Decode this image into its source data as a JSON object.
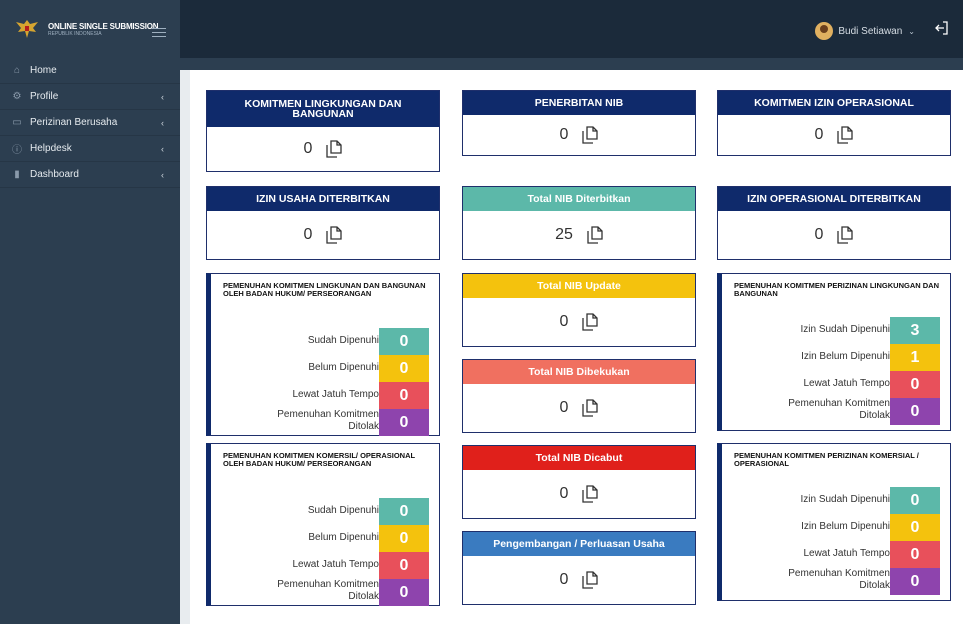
{
  "header": {
    "brand_title": "ONLINE SINGLE SUBMISSION",
    "brand_sub": "REPUBLIK INDONESIA",
    "user_name": "Budi Setiawan"
  },
  "sidebar": {
    "items": [
      {
        "label": "Home",
        "icon": "home-icon"
      },
      {
        "label": "Profile",
        "icon": "gear-icon"
      },
      {
        "label": "Perizinan Berusaha",
        "icon": "document-icon"
      },
      {
        "label": "Helpdesk",
        "icon": "info-icon"
      },
      {
        "label": "Dashboard",
        "icon": "bar-chart-icon"
      }
    ]
  },
  "cards": {
    "komitmen_lingkungan": {
      "title": "KOMITMEN LINGKUNGAN DAN BANGUNAN",
      "value": "0"
    },
    "penerbitan_nib": {
      "title": "PENERBITAN NIB",
      "value": "0"
    },
    "komitmen_izin_operasional": {
      "title": "KOMITMEN IZIN OPERASIONAL",
      "value": "0"
    },
    "izin_usaha": {
      "title": "IZIN USAHA DITERBITKAN",
      "value": "0"
    },
    "total_nib": {
      "title": "Total NIB Diterbitkan",
      "value": "25"
    },
    "izin_operasional": {
      "title": "IZIN OPERASIONAL DITERBITKAN",
      "value": "0"
    },
    "nib_update": {
      "title": "Total NIB Update",
      "value": "0"
    },
    "nib_dibekukan": {
      "title": "Total NIB Dibekukan",
      "value": "0"
    },
    "nib_dicabut": {
      "title": "Total NIB Dicabut",
      "value": "0"
    },
    "pengembangan": {
      "title": "Pengembangan / Perluasan Usaha",
      "value": "0"
    }
  },
  "stats": {
    "lingkungan_badan": {
      "title": "PEMENUHAN KOMITMEN LINGKUNAN DAN BANGUNAN OLEH BADAN HUKUM/ PERSEORANGAN",
      "rows": [
        {
          "label": "Sudah Dipenuhi",
          "value": "0"
        },
        {
          "label": "Belum Dipenuhi",
          "value": "0"
        },
        {
          "label": "Lewat Jatuh Tempo",
          "value": "0"
        },
        {
          "label": "Pemenuhan Komitmen Ditolak",
          "value": "0"
        }
      ]
    },
    "perizinan_lingkungan": {
      "title": "PEMENUHAN KOMITMEN PERIZINAN LINGKUNGAN DAN BANGUNAN",
      "rows": [
        {
          "label": "Izin Sudah Dipenuhi",
          "value": "3"
        },
        {
          "label": "Izin Belum Dipenuhi",
          "value": "1"
        },
        {
          "label": "Lewat Jatuh Tempo",
          "value": "0"
        },
        {
          "label": "Pemenuhan Komitmen Ditolak",
          "value": "0"
        }
      ]
    },
    "komersil_badan": {
      "title": "PEMENUHAN KOMITMEN KOMERSIL/ OPERASIONAL OLEH BADAN HUKUM/ PERSEORANGAN",
      "rows": [
        {
          "label": "Sudah Dipenuhi",
          "value": "0"
        },
        {
          "label": "Belum Dipenuhi",
          "value": "0"
        },
        {
          "label": "Lewat Jatuh Tempo",
          "value": "0"
        },
        {
          "label": "Pemenuhan Komitmen Ditolak",
          "value": "0"
        }
      ]
    },
    "perizinan_komersial": {
      "title": "PEMENUHAN KOMITMEN PERIZINAN KOMERSIAL / OPERASIONAL",
      "rows": [
        {
          "label": "Izin Sudah Dipenuhi",
          "value": "0"
        },
        {
          "label": "Izin Belum Dipenuhi",
          "value": "0"
        },
        {
          "label": "Lewat Jatuh Tempo",
          "value": "0"
        },
        {
          "label": "Pemenuhan Komitmen Ditolak",
          "value": "0"
        }
      ]
    }
  }
}
